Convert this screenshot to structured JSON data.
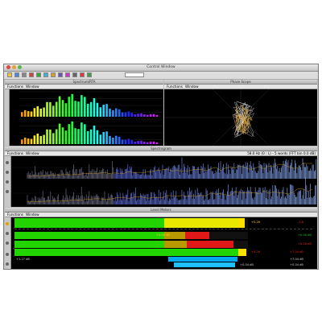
{
  "window": {
    "title": "Control Window",
    "traffic_lights": [
      "#e0443e",
      "#dea236",
      "#5ab54b"
    ]
  },
  "toolbar": {
    "icons": [
      "open-icon",
      "save-icon",
      "print-icon",
      "meter-icon",
      "spectrum-icon",
      "scope-icon",
      "rta-icon",
      "level-icon",
      "phase-icon",
      "settings-icon",
      "record-icon",
      "play-icon"
    ],
    "zoom_value": ""
  },
  "panels": {
    "rta": {
      "title": "Spectrum/RTA",
      "menu": [
        "Functions",
        "Window"
      ]
    },
    "scope": {
      "title": "Phase Scope",
      "menu": [
        "Functions",
        "Window"
      ]
    },
    "spectrum": {
      "title": "Spectrogram",
      "menu": [
        "Functions",
        "Window"
      ],
      "status": "58.0 Hz (0 : L) - 5 words (FFT bin 0.0 dB)"
    },
    "meters": {
      "title": "Level Meters",
      "menu": [
        "Functions",
        "Window"
      ],
      "rows": [
        {
          "label": "L",
          "value_right": "-1.8",
          "peak": "+0.26",
          "level": 0.93,
          "color": "#e02020"
        },
        {
          "label": "R",
          "value_right": "+0.00 dB",
          "peak": "+0.00",
          "level": 0.59,
          "color": "#23c223"
        },
        {
          "label": "C",
          "value_right": "+0.26 dB",
          "peak": "+0.26",
          "level": 0.93,
          "color": "#e02020"
        }
      ],
      "corr_left": "+1.27 dB",
      "corr_right": "+7.04 dB",
      "corr_right2": "+7.04 dB",
      "phase_right": "+0.04 dB",
      "mid_label": "+4.00 dB"
    }
  }
}
